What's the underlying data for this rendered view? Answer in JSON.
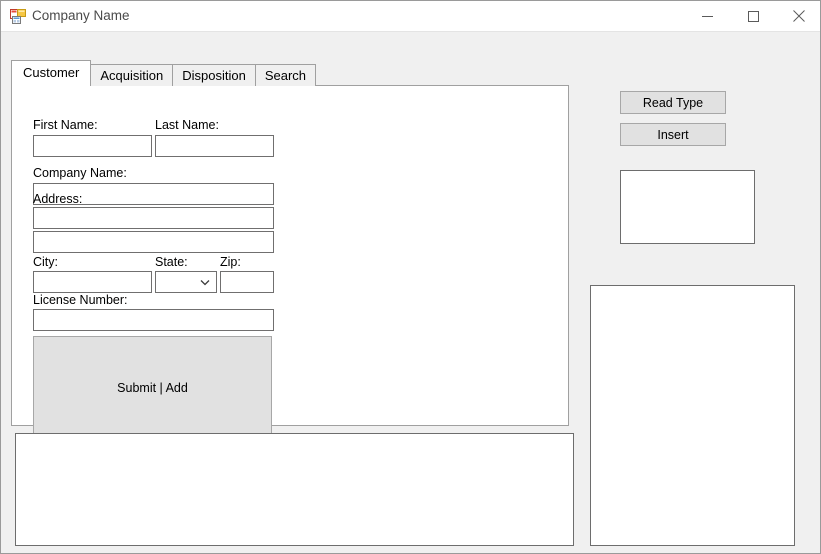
{
  "window": {
    "title": "Company Name",
    "icon": "winforms-app-icon",
    "controls": {
      "minimize_label": "Minimize",
      "maximize_label": "Maximize",
      "close_label": "Close"
    },
    "colors": {
      "client_background": "#f0f0f0",
      "titlebar_background": "#ffffff",
      "field_border": "#706f6f",
      "button_face": "#e1e1e1",
      "panel_border": "#6d6d6d",
      "accent": "#0078d7"
    }
  },
  "tabs": [
    {
      "label": "Customer",
      "selected": true
    },
    {
      "label": "Acquisition",
      "selected": false
    },
    {
      "label": "Disposition",
      "selected": false
    },
    {
      "label": "Search",
      "selected": false
    }
  ],
  "customer_form": {
    "first_name": {
      "label": "First Name:",
      "value": "",
      "placeholder": ""
    },
    "last_name": {
      "label": "Last Name:",
      "value": "",
      "placeholder": ""
    },
    "company_name": {
      "label": "Company Name:",
      "value": "",
      "placeholder": ""
    },
    "address": {
      "label": "Address:",
      "value": "",
      "placeholder": ""
    },
    "address2": {
      "value": "",
      "placeholder": ""
    },
    "city": {
      "label": "City:",
      "value": "",
      "placeholder": ""
    },
    "state": {
      "label": "State:",
      "value": "",
      "options": []
    },
    "zip": {
      "label": "Zip:",
      "value": "",
      "placeholder": ""
    },
    "license_number": {
      "label": "License Number:",
      "value": "",
      "placeholder": ""
    },
    "submit": {
      "label": "Submit | Add"
    }
  },
  "side_actions": {
    "read_type_label": "Read Type",
    "insert_label": "Insert"
  },
  "output": {
    "small_panel_text": "",
    "tall_panel_text": "",
    "wide_panel_text": ""
  }
}
